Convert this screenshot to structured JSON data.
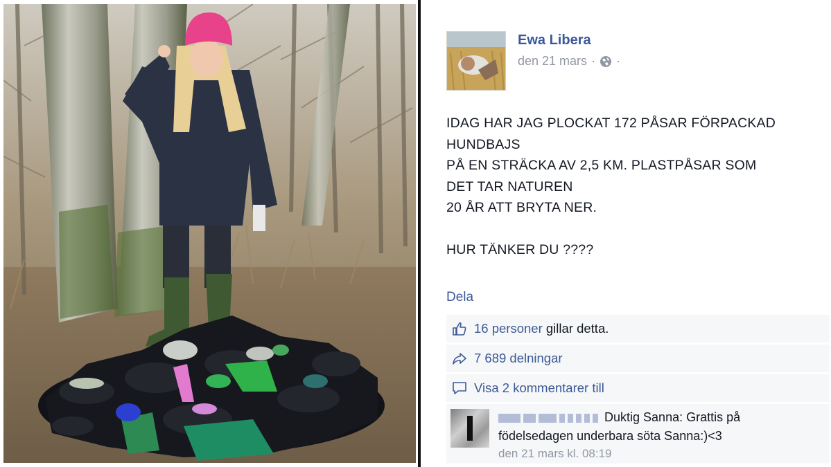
{
  "post": {
    "author": "Ewa Libera",
    "date": "den 21 mars",
    "separator": "·",
    "trailing_dot": "·",
    "audience_icon": "globe-icon",
    "lines": [
      "IDAG HAR JAG PLOCKAT 172 PÅSAR FÖRPACKAD",
      "HUNDBAJS",
      "PÅ EN STRÄCKA AV 2,5 KM. PLASTPÅSAR SOM",
      "DET TAR NATUREN",
      "20 ÅR ATT BRYTA NER.",
      "",
      "HUR TÄNKER DU ????"
    ],
    "share_label": "Dela"
  },
  "ufi": {
    "likes_link": "16 personer",
    "likes_suffix": " gillar detta.",
    "shares_link": "7 689 delningar",
    "comments_link": "Visa 2 kommentarer till"
  },
  "comment": {
    "text_line1": "Duktig Sanna: Grattis på",
    "text_line2": "födelsedagen underbara söta Sanna:)<3",
    "timestamp": "den 21 mars kl. 08:19"
  },
  "colors": {
    "link": "#3b5998",
    "text": "#141823",
    "muted": "#9197a3",
    "ufi_bg": "#f6f7f8"
  }
}
